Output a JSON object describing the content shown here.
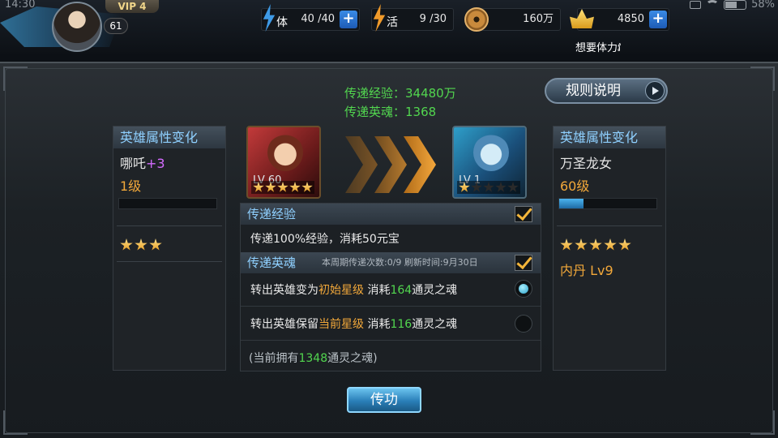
{
  "system": {
    "time": "14:30",
    "battery": "58%"
  },
  "player": {
    "vip": "VIP 4",
    "level": "61"
  },
  "resources": {
    "stamina": {
      "label": "体",
      "value": "40 /40"
    },
    "energy": {
      "label": "活",
      "value": "9 /30"
    },
    "copper": {
      "value": "160万"
    },
    "gold": {
      "value": "4850"
    }
  },
  "hint": "想要体力វ",
  "transfer_info": {
    "exp_line": "传递经验：34480万",
    "soul_line": "传递英魂：1368"
  },
  "rules_button": "规则说明",
  "left_panel": {
    "title": "英雄属性变化",
    "hero_name": "哪吒",
    "hero_plus": "+3",
    "level_text": "1级",
    "stars": 3,
    "exp_fill": 0
  },
  "right_panel": {
    "title": "英雄属性变化",
    "hero_name": "万圣龙女",
    "level_text": "60级",
    "stars": 5,
    "exp_fill": 0.25,
    "neidan": "内丹 Lv9"
  },
  "hero_left_card": {
    "lv": "LV 60",
    "stars": 5
  },
  "hero_right_card": {
    "lv": "LV 1",
    "stars": 1
  },
  "section_exp": {
    "title": "传递经验",
    "desc": "传递100%经验，消耗50元宝",
    "checked": true
  },
  "section_soul": {
    "title": "传递英魂",
    "sub": "本周期传递次数:0/9 刷新时间:9月30日",
    "checked": true,
    "option1": {
      "pre": "转出英雄变为",
      "hl": "初始星级",
      "mid": " 消耗",
      "num": "164",
      "post": "通灵之魂",
      "selected": true
    },
    "option2": {
      "pre": "转出英雄保留",
      "hl": "当前星级",
      "mid": " 消耗",
      "num": "116",
      "post": "通灵之魂",
      "selected": false
    },
    "owned": {
      "pre": "(当前拥有",
      "num": "1348",
      "post": "通灵之魂)"
    }
  },
  "transfer_button": "传功",
  "colors": {
    "accent_green": "#52d64f",
    "accent_orange": "#f2a83a",
    "title_blue": "#8fd0ff"
  }
}
